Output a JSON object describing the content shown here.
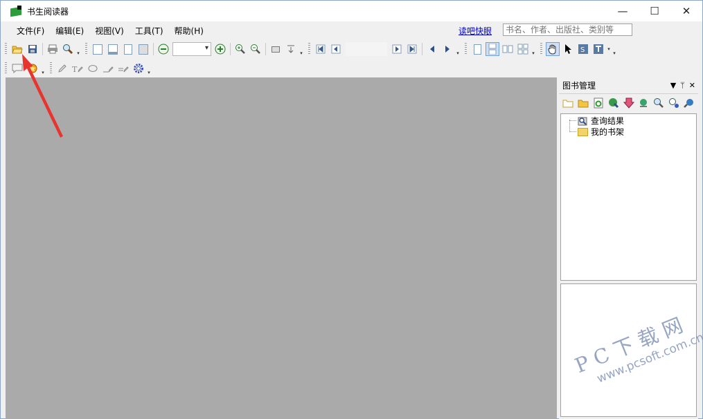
{
  "window": {
    "title": "书生阅读器"
  },
  "window_controls": {
    "minimize": "—",
    "maximize": "☐",
    "close": "✕"
  },
  "menu": [
    "文件(F)",
    "编辑(E)",
    "视图(V)",
    "工具(T)",
    "帮助(H)"
  ],
  "quicklink": "读吧快眼",
  "search": {
    "placeholder": "书名、作者、出版社、类别等"
  },
  "panel": {
    "title": "图书管理",
    "tree": [
      "查询结果",
      "我的书架"
    ]
  },
  "watermark": {
    "line1": "PC下载网",
    "line2": "www.pcsoft.com.cn"
  },
  "colors": {
    "canvas": "#aaaaaa",
    "accent_arrow": "#e8342f",
    "link": "#0000cc"
  }
}
